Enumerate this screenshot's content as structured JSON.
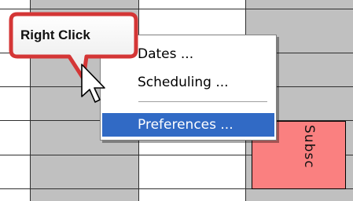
{
  "callout": {
    "label": "Right Click"
  },
  "context_menu": {
    "items": [
      {
        "label": "Dates ...",
        "selected": false
      },
      {
        "label": "Scheduling ...",
        "selected": false
      },
      {
        "label": "Preferences ...",
        "selected": true
      }
    ]
  },
  "appointment": {
    "label": "Subsc",
    "color": "#fa8080"
  },
  "colors": {
    "grid_shaded": "#c0c0c0",
    "grid_line": "#2f2f2f",
    "menu_highlight": "#316ac5",
    "callout_border": "#d43636"
  },
  "icons": {
    "pointer": "arrow-cursor-icon"
  }
}
